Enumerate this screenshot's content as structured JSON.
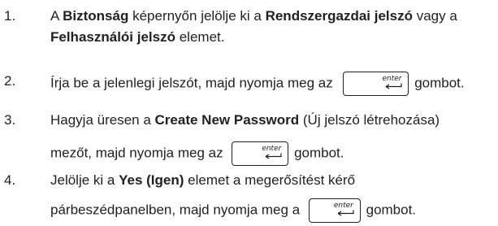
{
  "steps": [
    {
      "number": "1.",
      "lines": [
        {
          "t1": "A ",
          "b1": "Biztonság",
          "t2": " képernyőn jelölje ki a ",
          "b2": "Rendszergazdai jelszó",
          "t3": " vagy a"
        },
        {
          "b1": "Felhasználói jelszó",
          "t1": " elemet."
        }
      ]
    },
    {
      "number": "2.",
      "lines": [
        {
          "t1": "Írja be a jelenlegi jelszót, majd nyomja meg az",
          "t2": "gombot."
        }
      ]
    },
    {
      "number": "3.",
      "lines": [
        {
          "t1": "Hagyja üresen a ",
          "b1": "Create New Password",
          "t2": " (Új jelszó létrehozása)"
        },
        {
          "t1": "mezőt, majd nyomja meg az",
          "t2": "gombot."
        }
      ]
    },
    {
      "number": "4.",
      "lines": [
        {
          "t1": "Jelölje ki a ",
          "b1": "Yes (Igen)",
          "t2": " elemet a megerősítést kérő"
        },
        {
          "t1": "párbeszédpanelben, majd nyomja meg a",
          "t2": "gombot."
        }
      ]
    }
  ],
  "enter_key": {
    "label": "enter",
    "icon": "enter-return-arrow-icon"
  }
}
